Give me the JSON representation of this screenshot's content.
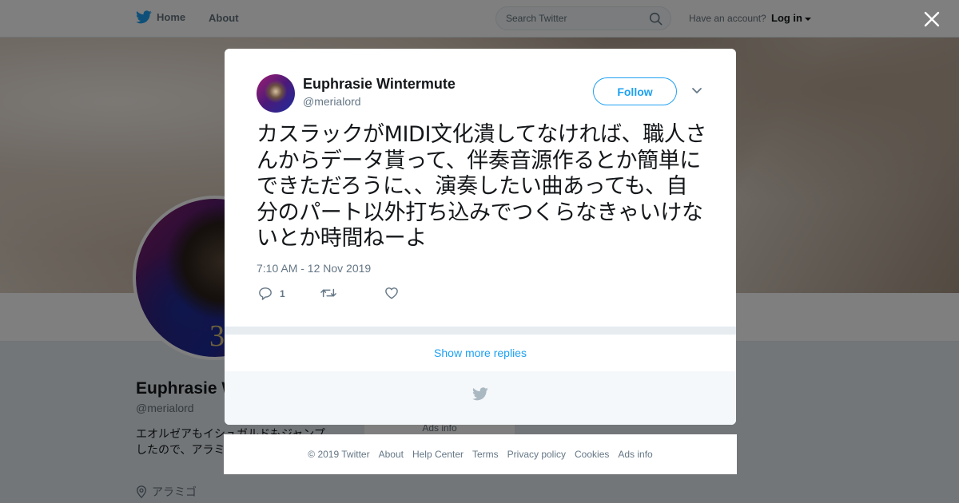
{
  "nav": {
    "home": "Home",
    "about": "About",
    "search_placeholder": "Search Twitter",
    "account_prompt": "Have an account?",
    "login": "Log in"
  },
  "profile": {
    "name": "Euphrasie W",
    "handle": "@merialord",
    "bio": "エオルゼアもイシュガルドもジャンプしたので、アラミゴ ークついてる星占",
    "location": "アラミゴ",
    "ads_info": "Ads info",
    "avatar_badge": "3"
  },
  "tweet": {
    "name": "Euphrasie Wintermute",
    "handle": "@merialord",
    "follow_label": "Follow",
    "text": "カスラックがMIDI文化潰してなければ、職人さんからデータ貰って、伴奏音源作るとか簡単にできただろうに、、演奏したい曲あっても、自分のパート以外打ち込みでつくらなきゃいけないとか時間ねーよ",
    "timestamp": "7:10 AM - 12 Nov 2019",
    "reply_count": "1",
    "retweet_count": "",
    "like_count": ""
  },
  "show_more_replies": "Show more replies",
  "footer": {
    "links": [
      "© 2019 Twitter",
      "About",
      "Help Center",
      "Terms",
      "Privacy policy",
      "Cookies",
      "Ads info"
    ]
  },
  "colors": {
    "accent": "#1da1f2",
    "text_primary": "#14171a",
    "text_secondary": "#657786"
  },
  "icons": {
    "logo": "twitter-bird-icon",
    "search": "search-icon",
    "close": "close-icon",
    "more": "chevron-down-icon",
    "reply": "reply-icon",
    "retweet": "retweet-icon",
    "like": "heart-icon",
    "location": "location-pin-icon"
  }
}
